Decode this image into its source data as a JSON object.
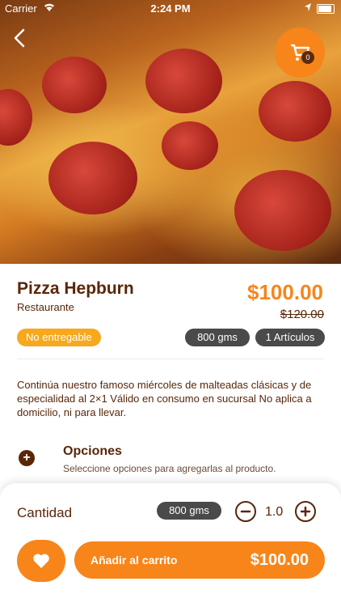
{
  "status_bar": {
    "carrier": "Carrier",
    "time": "2:24 PM"
  },
  "product": {
    "name": "Pizza Hepburn",
    "store": "Restaurante",
    "price": "$100.00",
    "old_price": "$120.00",
    "delivery_badge": "No entregable",
    "weight": "800 gms",
    "items": "1 Artículos",
    "description": " Continúa nuestro famoso miércoles de malteadas clásicas y de especialidad al 2×1  Válido en consumo en sucursal  No aplica a domicilio, ni para llevar."
  },
  "cart": {
    "count": "0"
  },
  "options": {
    "title": "Opciones",
    "subtitle": "Seleccione opciones para agregarlas al producto."
  },
  "quantity": {
    "label": "Cantidad",
    "weight": "800 gms",
    "value": "1.0"
  },
  "footer": {
    "add_label": "Añadir al carrito",
    "total": "$100.00"
  },
  "colors": {
    "accent": "#f7851a",
    "brown": "#5a2608",
    "chip": "#4a4a4a",
    "badge": "#f7a81c"
  }
}
